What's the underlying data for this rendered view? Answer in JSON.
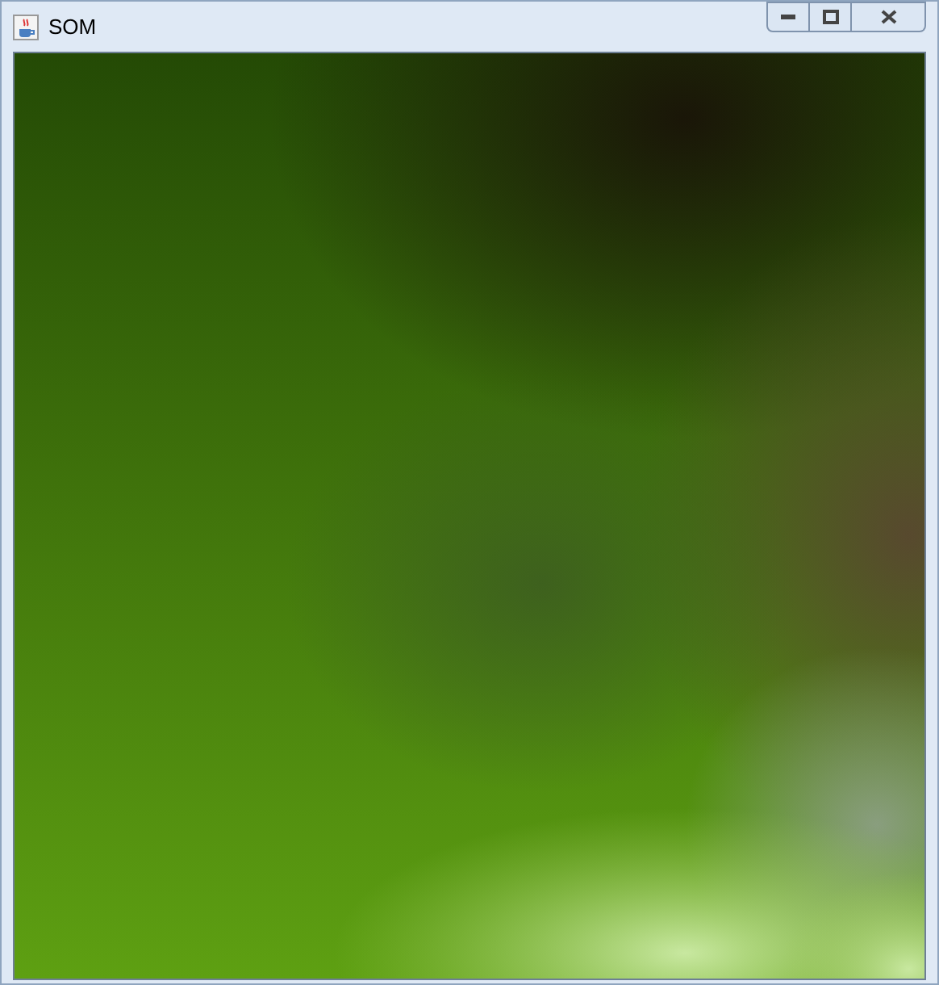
{
  "window": {
    "title": "SOM"
  }
}
